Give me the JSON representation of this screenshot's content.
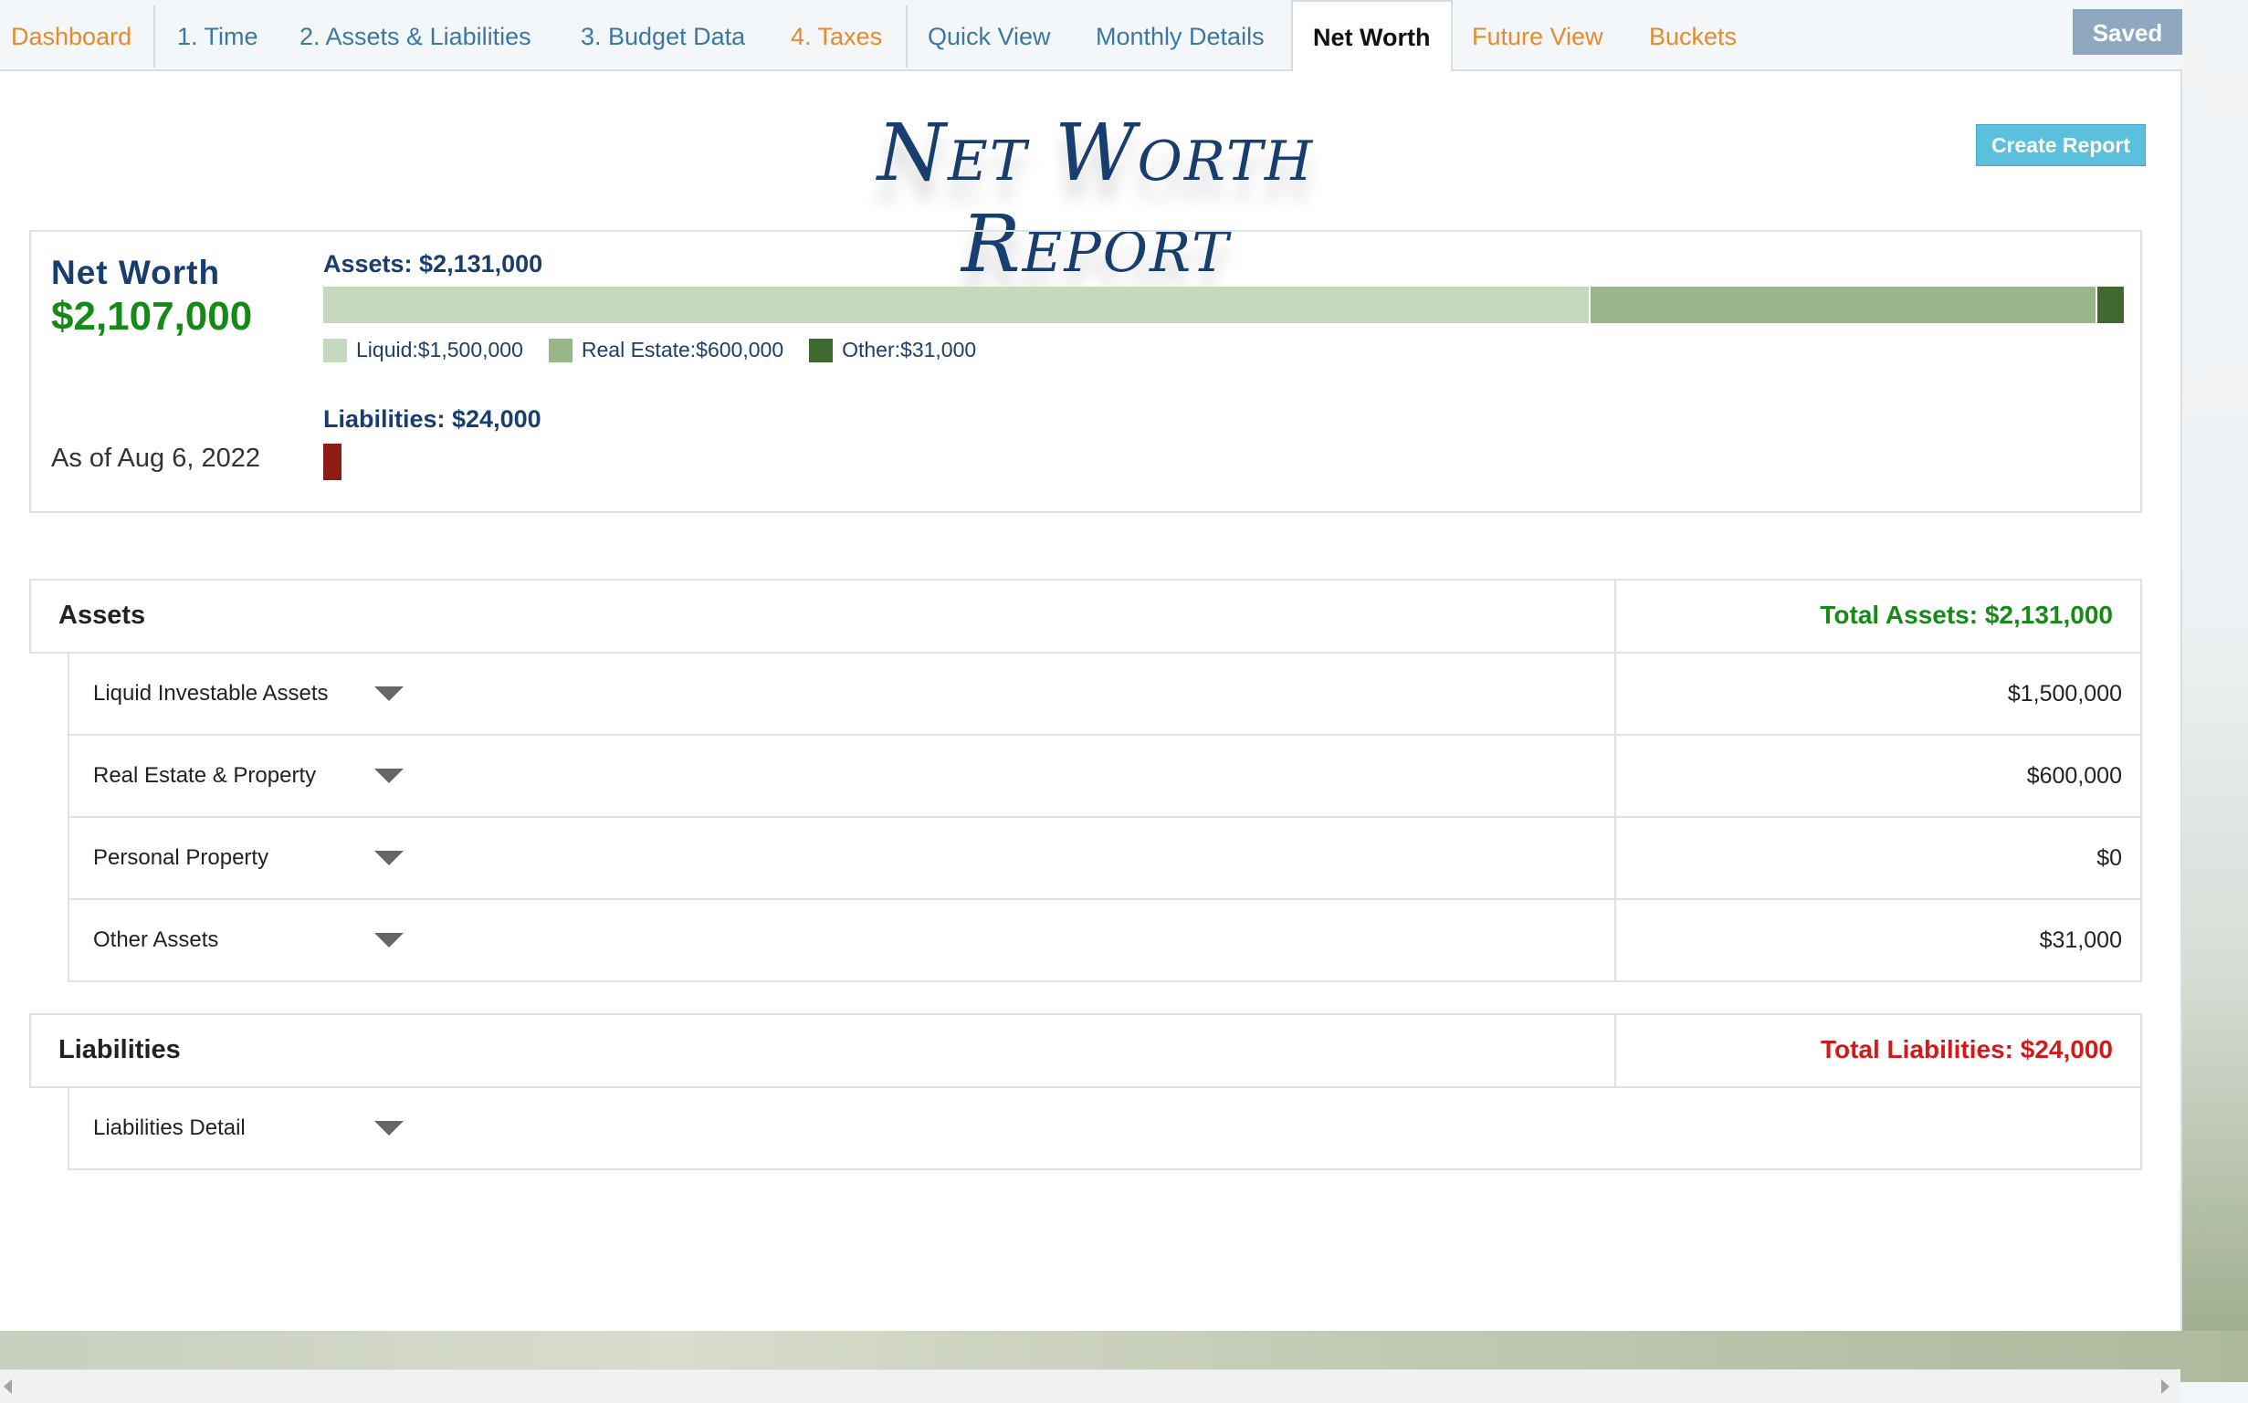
{
  "tabs": [
    {
      "label": "Dashboard",
      "style": "orange"
    },
    {
      "label": "1. Time",
      "style": "blue"
    },
    {
      "label": "2. Assets & Liabilities",
      "style": "blue"
    },
    {
      "label": "3. Budget Data",
      "style": "blue"
    },
    {
      "label": "4. Taxes",
      "style": "orange"
    },
    {
      "label": "Quick View",
      "style": "blue"
    },
    {
      "label": "Monthly Details",
      "style": "blue"
    },
    {
      "label": "Net Worth",
      "style": "active"
    },
    {
      "label": "Future View",
      "style": "orange"
    },
    {
      "label": "Buckets",
      "style": "orange"
    }
  ],
  "saved_label": "Saved",
  "report": {
    "title": "Net Worth Report",
    "create_label": "Create Report"
  },
  "summary": {
    "net_worth_label": "Net Worth",
    "net_worth_value": "$2,107,000",
    "as_of": "As of Aug 6, 2022",
    "assets_heading": "Assets: $2,131,000",
    "asset_bar": [
      {
        "name": "Liquid",
        "value": 1500000,
        "color": "#c5d9bc"
      },
      {
        "name": "Real Estate",
        "value": 600000,
        "color": "#98b68a"
      },
      {
        "name": "Other",
        "value": 31000,
        "color": "#3e6a2e"
      }
    ],
    "legend": {
      "liquid": "Liquid:$1,500,000",
      "real_estate": "Real Estate:$600,000",
      "other": "Other:$31,000"
    },
    "liabilities_heading": "Liabilities: $24,000",
    "liabilities_color": "#8e1c14"
  },
  "assets_section": {
    "title": "Assets",
    "total": "Total Assets: $2,131,000",
    "rows": [
      {
        "label": "Liquid Investable Assets",
        "value": "$1,500,000"
      },
      {
        "label": "Real Estate & Property",
        "value": "$600,000"
      },
      {
        "label": "Personal Property",
        "value": "$0"
      },
      {
        "label": "Other Assets",
        "value": "$31,000"
      }
    ]
  },
  "liabilities_section": {
    "title": "Liabilities",
    "total": "Total Liabilities: $24,000",
    "rows": [
      {
        "label": "Liabilities Detail"
      }
    ]
  }
}
